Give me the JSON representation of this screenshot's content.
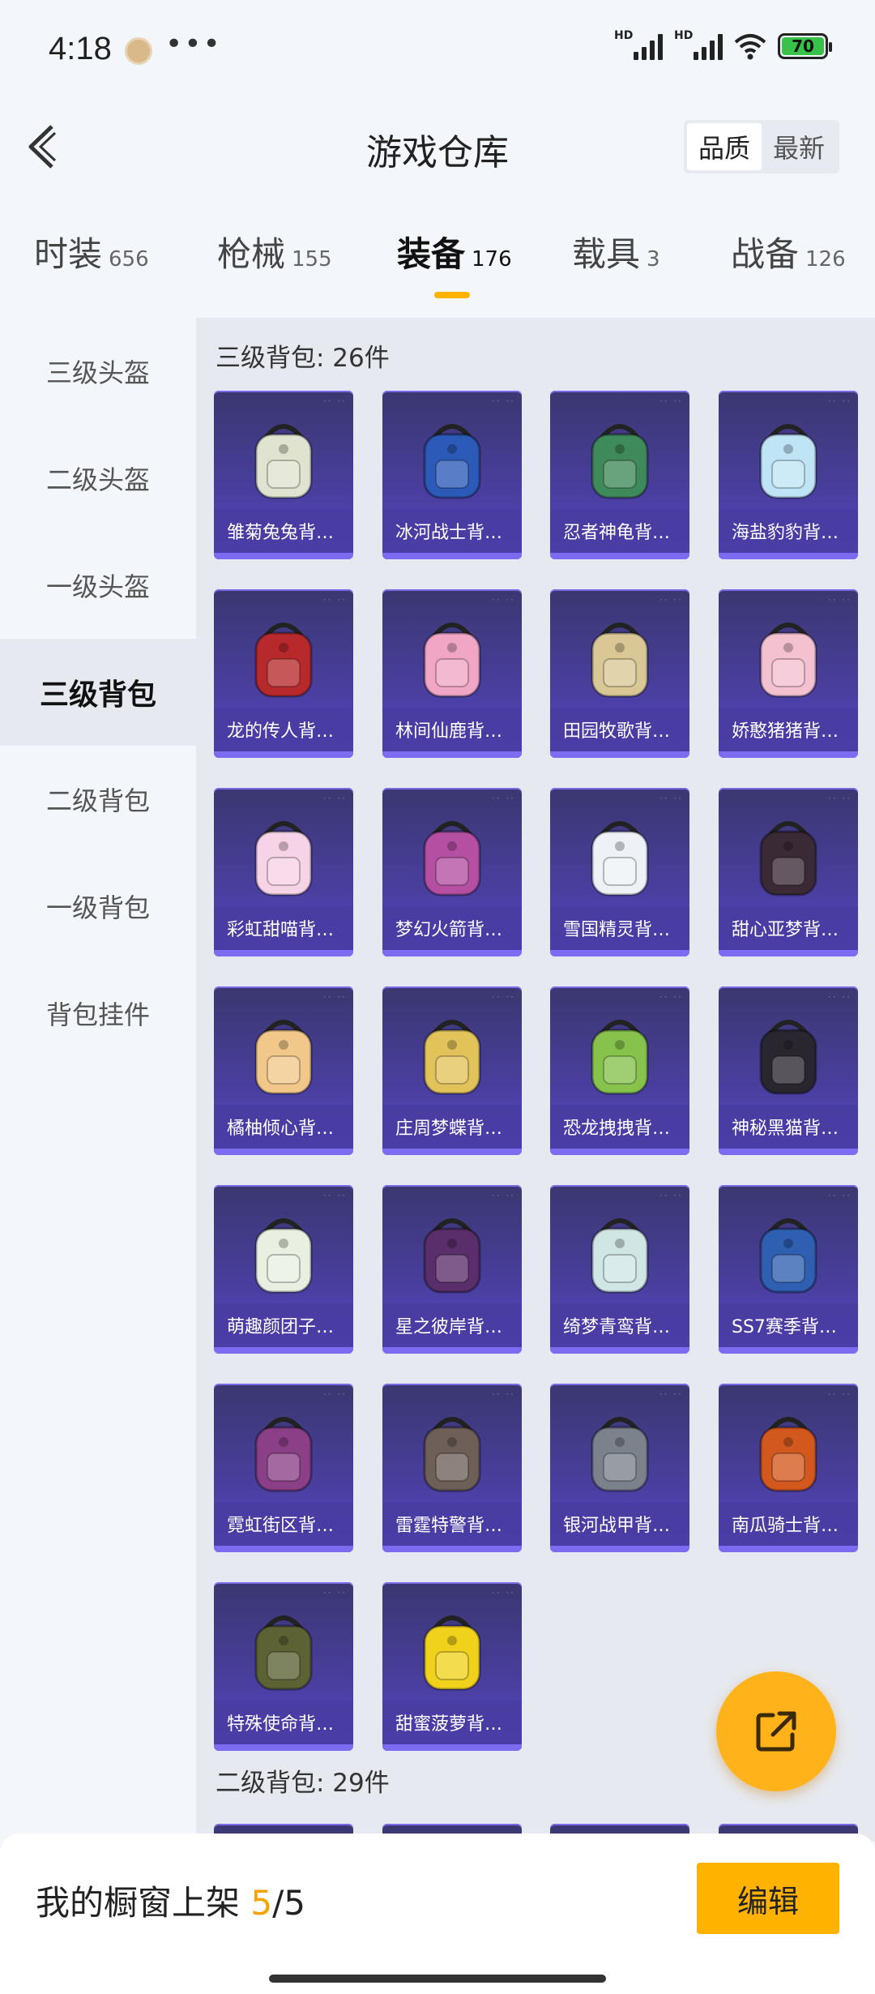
{
  "status_bar": {
    "time": "4:18",
    "more": "•••",
    "hd1": "HD",
    "hd2": "HD",
    "battery": "70"
  },
  "header": {
    "title": "游戏仓库",
    "sort_quality": "品质",
    "sort_newest": "最新"
  },
  "tabs": [
    {
      "label": "时装",
      "count": "656"
    },
    {
      "label": "枪械",
      "count": "155"
    },
    {
      "label": "装备",
      "count": "176"
    },
    {
      "label": "载具",
      "count": "3"
    },
    {
      "label": "战备",
      "count": "126"
    }
  ],
  "sidebar": [
    {
      "label": "三级头盔"
    },
    {
      "label": "二级头盔"
    },
    {
      "label": "一级头盔"
    },
    {
      "label": "三级背包"
    },
    {
      "label": "二级背包"
    },
    {
      "label": "一级背包"
    },
    {
      "label": "背包挂件"
    }
  ],
  "content": {
    "section1_title": "三级背包: 26件",
    "section2_title": "二级背包: 29件",
    "items": [
      {
        "name": "雏菊兔兔背…",
        "color": "#dfe3cf"
      },
      {
        "name": "冰河战士背…",
        "color": "#2b5ab8"
      },
      {
        "name": "忍者神龟背…",
        "color": "#3f8a5a"
      },
      {
        "name": "海盐豹豹背…",
        "color": "#bfe4f5"
      },
      {
        "name": "龙的传人背…",
        "color": "#b8292c"
      },
      {
        "name": "林间仙鹿背…",
        "color": "#f0a6c4"
      },
      {
        "name": "田园牧歌背…",
        "color": "#d9c896"
      },
      {
        "name": "娇憨猪猪背…",
        "color": "#f4c1d1"
      },
      {
        "name": "彩虹甜喵背…",
        "color": "#f6d3e6"
      },
      {
        "name": "梦幻火箭背…",
        "color": "#b44fa2"
      },
      {
        "name": "雪国精灵背…",
        "color": "#eef2f6"
      },
      {
        "name": "甜心亚梦背…",
        "color": "#3a2a36"
      },
      {
        "name": "橘柚倾心背…",
        "color": "#f2c88a"
      },
      {
        "name": "庄周梦蝶背…",
        "color": "#e2c35a"
      },
      {
        "name": "恐龙拽拽背…",
        "color": "#86c24c"
      },
      {
        "name": "神秘黑猫背…",
        "color": "#2a2630"
      },
      {
        "name": "萌趣颜团子…",
        "color": "#e9f0e2"
      },
      {
        "name": "星之彼岸背…",
        "color": "#5a2e6a"
      },
      {
        "name": "绮梦青鸾背…",
        "color": "#cfe6e4"
      },
      {
        "name": "SS7赛季背…",
        "color": "#2f5fb0"
      },
      {
        "name": "霓虹街区背…",
        "color": "#8a3f86"
      },
      {
        "name": "雷霆特警背…",
        "color": "#6e5f58"
      },
      {
        "name": "银河战甲背…",
        "color": "#7c828c"
      },
      {
        "name": "南瓜骑士背…",
        "color": "#d2581e"
      },
      {
        "name": "特殊使命背…",
        "color": "#5c6234"
      },
      {
        "name": "甜蜜菠萝背…",
        "color": "#f0d21c"
      }
    ]
  },
  "bottom": {
    "label_prefix": "我的橱窗上架 ",
    "current": "5",
    "separator_total": "/5",
    "edit_label": "编辑"
  },
  "colors": {
    "accent": "#ffb300",
    "card_bg": "#4a3fa0"
  }
}
